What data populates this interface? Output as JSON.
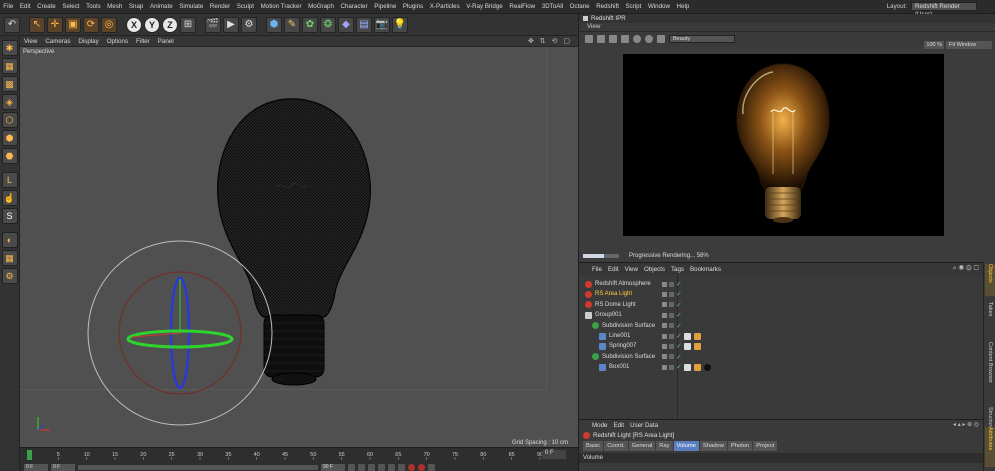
{
  "menubar": {
    "items": [
      "File",
      "Edit",
      "Create",
      "Select",
      "Tools",
      "Mesh",
      "Snap",
      "Animate",
      "Simulate",
      "Render",
      "Sculpt",
      "Motion Tracker",
      "MoGraph",
      "Character",
      "Pipeline",
      "Plugins",
      "X-Particles",
      "V-Ray Bridge",
      "RealFlow",
      "3DToAll",
      "Octane",
      "Redshift",
      "Script",
      "Window",
      "Help"
    ],
    "layout_label": "Layout:",
    "layout_value": "Redshift Render (User)"
  },
  "toolbar": {
    "icons": [
      "undo-icon",
      "live-selection-icon",
      "move-icon",
      "scale-icon",
      "rotate-icon",
      "recent-tools-icon",
      "x-axis-lock-icon",
      "y-axis-lock-icon",
      "z-axis-lock-icon",
      "coordinate-system-icon",
      "render-view-icon",
      "render-picture-viewer-icon",
      "render-settings-icon",
      "cube-icon",
      "pen-spline-icon",
      "subdivision-icon",
      "array-icon",
      "deformer-icon",
      "floor-icon",
      "camera-icon",
      "light-icon"
    ],
    "axis_labels": [
      "X",
      "Y",
      "Z"
    ]
  },
  "viewport": {
    "menu": [
      "View",
      "Cameras",
      "Display",
      "Options",
      "Filter",
      "Panel"
    ],
    "label": "Perspective",
    "grid_spacing": "Grid Spacing : 10 cm"
  },
  "timeline": {
    "ticks": [
      "0",
      "5",
      "10",
      "15",
      "20",
      "25",
      "30",
      "35",
      "40",
      "45",
      "50",
      "55",
      "60",
      "65",
      "70",
      "75",
      "80",
      "85",
      "90"
    ],
    "start_frame": "0 F",
    "current_frame": "0 F",
    "end_frame": "90 F"
  },
  "ipr": {
    "title": "Redshift IPR",
    "view_label": "View",
    "aov_select": "Beauty",
    "zoom": "100 %",
    "fit": "Fit Window",
    "status": "Progressive Rendering... 58%",
    "progress": 0.58
  },
  "object_manager": {
    "menu": [
      "File",
      "Edit",
      "View",
      "Objects",
      "Tags",
      "Bookmarks"
    ],
    "rows": [
      {
        "name": "Redshift Atmosphere",
        "icon": "redshift-light-icon",
        "indent": 0,
        "selected": false
      },
      {
        "name": "RS Area Light",
        "icon": "redshift-light-icon",
        "indent": 0,
        "selected": true
      },
      {
        "name": "RS Dome Light",
        "icon": "redshift-light-icon",
        "indent": 0,
        "selected": false
      },
      {
        "name": "Group001",
        "icon": "null-group-icon",
        "indent": 0,
        "selected": false
      },
      {
        "name": "Subdivision Surface",
        "icon": "subdivision-surface-icon",
        "indent": 1,
        "selected": false
      },
      {
        "name": "Line001",
        "icon": "spline-icon",
        "indent": 2,
        "selected": false
      },
      {
        "name": "Spring007",
        "icon": "spline-icon",
        "indent": 2,
        "selected": false
      },
      {
        "name": "Subdivision Surface",
        "icon": "subdivision-surface-icon",
        "indent": 1,
        "selected": false
      },
      {
        "name": "Box001",
        "icon": "polygon-object-icon",
        "indent": 2,
        "selected": false
      }
    ]
  },
  "side_tabs": [
    "Objects",
    "Takes",
    "Content Browser",
    "Structure",
    "Attributes"
  ],
  "attributes": {
    "menu": [
      "Mode",
      "Edit",
      "User Data"
    ],
    "title": "Redshift Light [RS Area Light]",
    "tabs": [
      "Basic",
      "Coord.",
      "General",
      "Ray",
      "Volume",
      "Shadow",
      "Photon",
      "Project"
    ],
    "active_tab": "Volume",
    "section": "Volume"
  },
  "colors": {
    "accent_orange": "#ffb84d",
    "selection_yellow": "#ffd040",
    "active_tab_blue": "#5a7fc0",
    "axis_x": "#d03a2a",
    "axis_y": "#2ed42e",
    "axis_z": "#2a3ad0"
  }
}
